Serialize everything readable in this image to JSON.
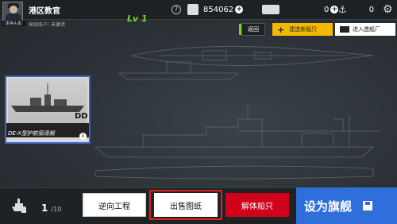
{
  "header": {
    "avatar_caption": "更换头像",
    "title": "港区教官",
    "account_label": "高级账户:",
    "account_status": "未激活",
    "help_icon": "?",
    "level": "Lv 1"
  },
  "resources": [
    {
      "icon": "blueprint-icon",
      "value": "854062",
      "add": "+"
    },
    {
      "icon": "ships-icon",
      "value": "0",
      "add": "+"
    },
    {
      "icon": "anchor-icon",
      "value": "0",
      "add": ""
    }
  ],
  "nav": {
    "back_label": "返回",
    "build_label": "建造新船只",
    "yard_label": "进入造船厂"
  },
  "ship_card": {
    "hull_type": "DD",
    "name": "DE-X型护航驱逐舰",
    "info": "i"
  },
  "footer": {
    "count": "1",
    "count_total": "/10",
    "reverse_label": "逆向工程",
    "sell_label": "出售图纸",
    "scrap_label": "解体船只",
    "flagship_label": "设为旗舰"
  },
  "colors": {
    "accent_blue": "#2f6fdb",
    "accent_red": "#d0021b",
    "accent_yellow": "#f5b800",
    "level_green": "#7ed321",
    "card_border": "#3c64c8"
  }
}
